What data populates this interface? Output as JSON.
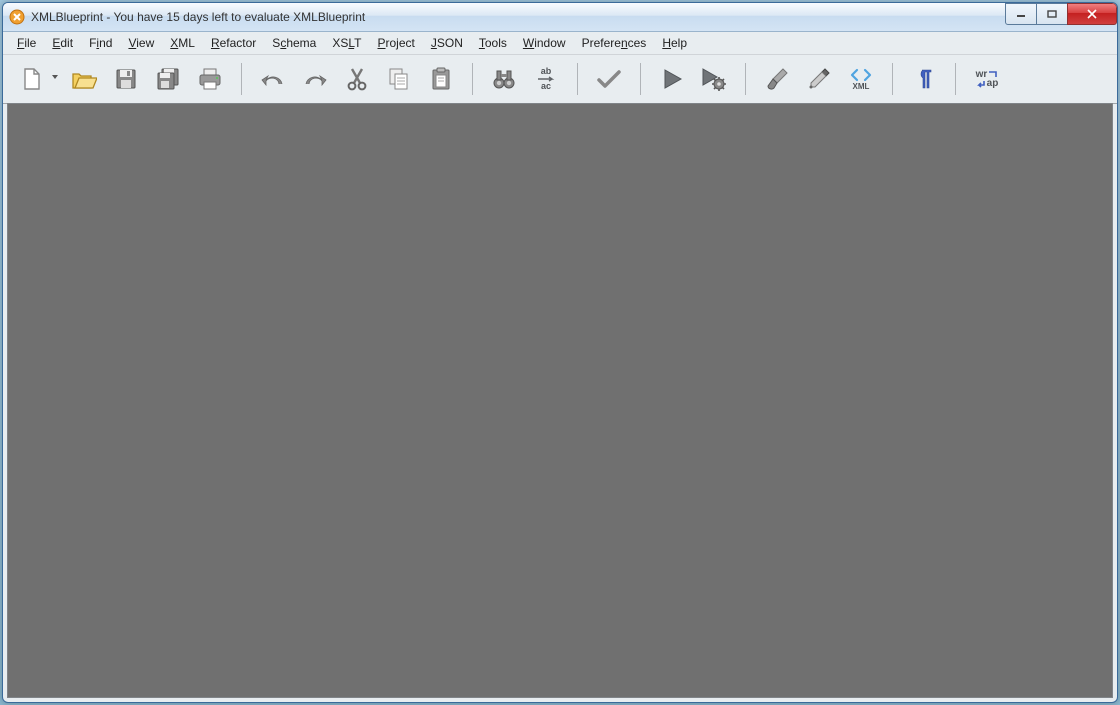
{
  "title": "XMLBlueprint - You have 15 days left to evaluate XMLBlueprint",
  "menu": {
    "file": "File",
    "edit": "Edit",
    "find": "Find",
    "view": "View",
    "xml": "XML",
    "refactor": "Refactor",
    "schema": "Schema",
    "xslt": "XSLT",
    "project": "Project",
    "json": "JSON",
    "tools": "Tools",
    "window": "Window",
    "preferences": "Preferences",
    "help": "Help"
  },
  "toolbar": {
    "new": "New",
    "open": "Open",
    "save": "Save",
    "saveall": "Save All",
    "print": "Print",
    "undo": "Undo",
    "redo": "Redo",
    "cut": "Cut",
    "copy": "Copy",
    "paste": "Paste",
    "find": "Find",
    "replace": "Replace",
    "validate": "Validate",
    "run": "Run",
    "runconfig": "Run Config",
    "format": "Format",
    "colorpicker": "Color Picker",
    "xml": "XML",
    "pilcrow": "Show Whitespace",
    "wrap": "Word Wrap",
    "replace_ab": "ab",
    "replace_ac": "ac",
    "xml_label": "XML",
    "wrap_wr": "wr",
    "wrap_ap": "ap"
  }
}
